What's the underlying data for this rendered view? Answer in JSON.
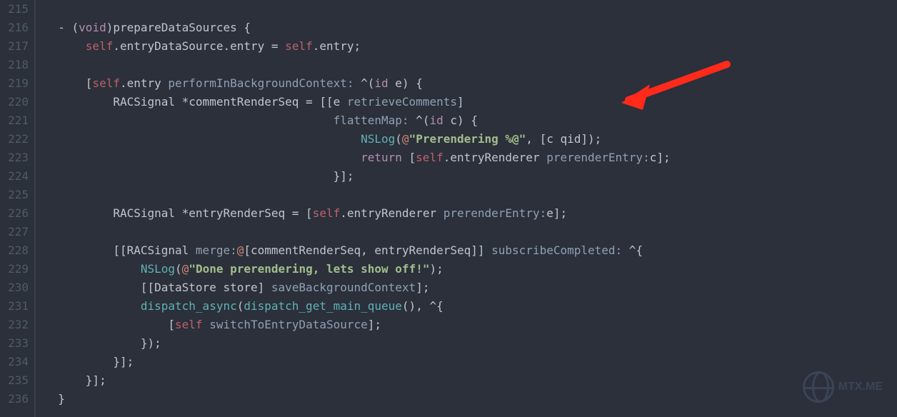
{
  "gutter": {
    "start": 215,
    "end": 236
  },
  "code": {
    "l215": "",
    "l216_pre": "  - (",
    "l216_void": "void",
    "l216_post": ")prepareDataSources {",
    "l217_a": "      ",
    "l217_self": "self",
    "l217_b": ".entryDataSource.entry = ",
    "l217_self2": "self",
    "l217_c": ".entry;",
    "l218": "",
    "l219_a": "      [",
    "l219_self": "self",
    "l219_b": ".entry ",
    "l219_fn": "performInBackgroundContext:",
    "l219_c": " ^(",
    "l219_ty": "id",
    "l219_d": " e) {",
    "l220_a": "          RACSignal *commentRenderSeq = [[e ",
    "l220_fn": "retrieveComments",
    "l220_b": "]",
    "l221_a": "                                          ",
    "l221_fn": "flattenMap:",
    "l221_b": " ^(",
    "l221_ty": "id",
    "l221_c": " c) {",
    "l222_a": "                                              ",
    "l222_call": "NSLog",
    "l222_b": "(",
    "l222_at": "@",
    "l222_str": "\"Prerendering %@\"",
    "l222_c": ", [c qid]);",
    "l223_a": "                                              ",
    "l223_ret": "return",
    "l223_b": " [",
    "l223_self": "self",
    "l223_c": ".entryRenderer ",
    "l223_fn": "prerenderEntry:",
    "l223_d": "c];",
    "l224": "                                          }];",
    "l225": "",
    "l226_a": "          RACSignal *entryRenderSeq = [",
    "l226_self": "self",
    "l226_b": ".entryRenderer ",
    "l226_fn": "prerenderEntry:",
    "l226_c": "e];",
    "l227": "",
    "l228_a": "          [[RACSignal ",
    "l228_fn1": "merge:",
    "l228_at": "@",
    "l228_b": "[commentRenderSeq, entryRenderSeq]] ",
    "l228_fn2": "subscribeCompleted:",
    "l228_c": " ^{",
    "l229_a": "              ",
    "l229_call": "NSLog",
    "l229_b": "(",
    "l229_at": "@",
    "l229_str": "\"Done prerendering, lets show off!\"",
    "l229_c": ");",
    "l230_a": "              [[DataStore store] ",
    "l230_fn": "saveBackgroundContext",
    "l230_b": "];",
    "l231_a": "              ",
    "l231_call1": "dispatch_async",
    "l231_b": "(",
    "l231_call2": "dispatch_get_main_queue",
    "l231_c": "(), ^{",
    "l232_a": "                  [",
    "l232_self": "self",
    "l232_b": " ",
    "l232_fn": "switchToEntryDataSource",
    "l232_c": "];",
    "l233": "              });",
    "l234": "          }];",
    "l235": "      }];",
    "l236": "  }"
  },
  "watermark": {
    "text": "MTX.ME"
  }
}
